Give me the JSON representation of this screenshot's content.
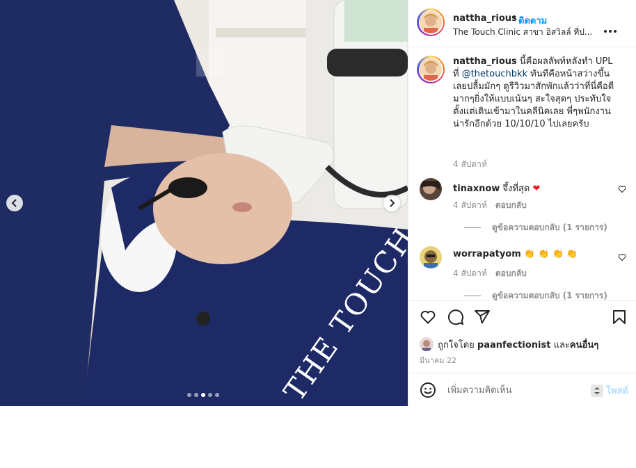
{
  "post": {
    "images_count": 5,
    "active_image_index": 2,
    "watermark_text": "THE TOUCH"
  },
  "header": {
    "username": "nattha_rious",
    "separator": "•",
    "follow_label": "ติดตาม",
    "location": "The Touch Clinic สาขา อิสวิลล์ ที่ป..."
  },
  "caption": {
    "username": "nattha_rious",
    "text_before": " นี้คือผลลัพท์หลังทำ UPL ที่ ",
    "mention": "@thetouchbkk",
    "text_after": " ทันทีคือหน้าสว่างขึ้นเลยปลื้มมักๆ ดูรีวิวมาสักพักแล้วว่าที่นี่คือดีมากๆยิ่งให้แบบเน้นๆ สะใจสุดๆ ประทับใจตั้งแต่เดินเข้ามาในคลีนิคเลย พี่ๆพนักงานน่ารักอีกด้วย 10/10/10 ไปเลยครับ",
    "time": "4 สัปดาห์"
  },
  "comments": [
    {
      "username": "tinaxnow",
      "text": " จึ้งที่สุด ",
      "emoji": "❤",
      "time": "4 สัปดาห์",
      "reply_label": "ตอบกลับ",
      "view_replies": "ดูข้อความตอบกลับ (1 รายการ)"
    },
    {
      "username": "worrapatyom",
      "text": " ",
      "emoji": "👏 👏 👏 👏",
      "time": "4 สัปดาห์",
      "reply_label": "ตอบกลับ",
      "view_replies": "ดูข้อความตอบกลับ (1 รายการ)"
    }
  ],
  "actions": {
    "like_icon": "heart-outline-icon",
    "comment_icon": "comment-bubble-icon",
    "share_icon": "paper-plane-icon",
    "save_icon": "bookmark-icon"
  },
  "likes": {
    "prefix": "ถูกใจโดย ",
    "user": "paanfectionist",
    "middle": " และ",
    "others": "คนอื่นๆ"
  },
  "date": "มีนาคม 22",
  "add_comment": {
    "placeholder": "เพิ่มความคิดเห็น",
    "post_label": "โพสต์"
  },
  "colors": {
    "accent": "#0095f6",
    "mention": "#00376b",
    "muted": "#8e8e8e",
    "heart": "#ed1c24",
    "post_disabled": "#b2dffc"
  }
}
